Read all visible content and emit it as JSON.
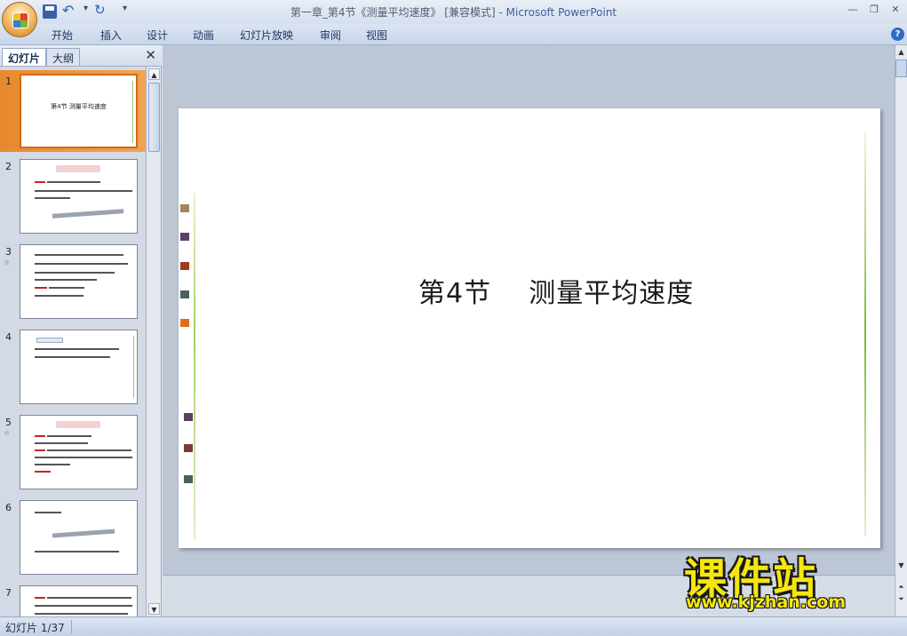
{
  "window": {
    "title": "第一章_第4节《测量平均速度》 [兼容模式] - ",
    "app_name": "Microsoft PowerPoint",
    "minimize": "—",
    "restore": "❐",
    "close": "✕"
  },
  "ribbon": {
    "tabs": [
      "开始",
      "插入",
      "设计",
      "动画",
      "幻灯片放映",
      "审阅",
      "视图"
    ],
    "help": "?"
  },
  "left_pane": {
    "tabs": [
      "幻灯片",
      "大纲"
    ],
    "close": "✕",
    "thumbnails": [
      {
        "num": "1",
        "title": "第4节    测量平均速度",
        "anim": ""
      },
      {
        "num": "2",
        "title": "",
        "anim": ""
      },
      {
        "num": "3",
        "title": "",
        "anim": "☆"
      },
      {
        "num": "4",
        "title": "",
        "anim": ""
      },
      {
        "num": "5",
        "title": "",
        "anim": "☆"
      },
      {
        "num": "6",
        "title": "",
        "anim": ""
      },
      {
        "num": "7",
        "title": "",
        "anim": ""
      }
    ]
  },
  "slide": {
    "title": "第4节    测量平均速度"
  },
  "status": {
    "slide_counter": "幻灯片 1/37"
  },
  "watermark": {
    "main": "课件站",
    "url": "www.kjzhan.com"
  },
  "colors": {
    "accent_green": "#7fb63a",
    "selection_orange": "#e7892e",
    "deco_squares": [
      "#a3875c",
      "#5c3f6b",
      "#9c3c1b",
      "#4b6065",
      "#e06c1c",
      "#5c3f6b",
      "#7a3b3b",
      "#4b6065"
    ]
  },
  "icons": {
    "office_button": "office-logo-icon",
    "save": "save-icon",
    "undo": "undo-icon",
    "redo": "redo-icon",
    "customize": "chevron-down-icon"
  }
}
